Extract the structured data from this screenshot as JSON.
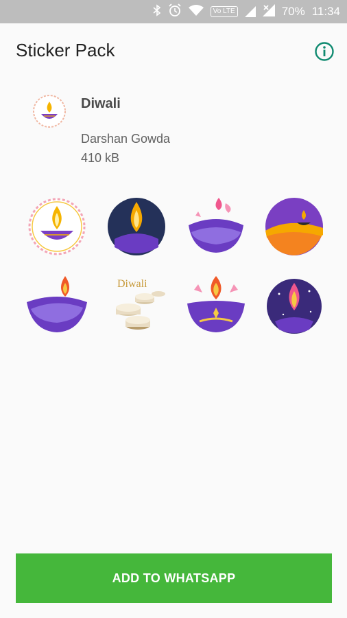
{
  "status_bar": {
    "icons": [
      "bluetooth-icon",
      "alarm-icon",
      "wifi-icon",
      "volte-icon",
      "signal-icon",
      "signal-no-data-icon"
    ],
    "volte_label": "Vo LTE",
    "battery": "70%",
    "time": "11:34"
  },
  "app_bar": {
    "title": "Sticker Pack",
    "info_icon": "info-icon"
  },
  "pack": {
    "name": "Diwali",
    "publisher": "Darshan Gowda",
    "size": "410 kB",
    "tray_icon": "diya-icon"
  },
  "stickers": [
    {
      "name": "diya-in-rangoli-sticker"
    },
    {
      "name": "diya-flame-navy-circle-sticker"
    },
    {
      "name": "diya-pink-flames-sticker"
    },
    {
      "name": "diya-desert-dunes-sticker"
    },
    {
      "name": "diya-purple-bowl-sticker"
    },
    {
      "name": "happy-diwali-candles-sticker",
      "text": "Diwali"
    },
    {
      "name": "diya-ornate-purple-sticker"
    },
    {
      "name": "diya-starry-circle-sticker"
    }
  ],
  "actions": {
    "add_label": "ADD TO WHATSAPP"
  },
  "colors": {
    "accent_green": "#45b73b",
    "info_teal": "#0f8a70",
    "status_bar": "#bdbdbd"
  }
}
